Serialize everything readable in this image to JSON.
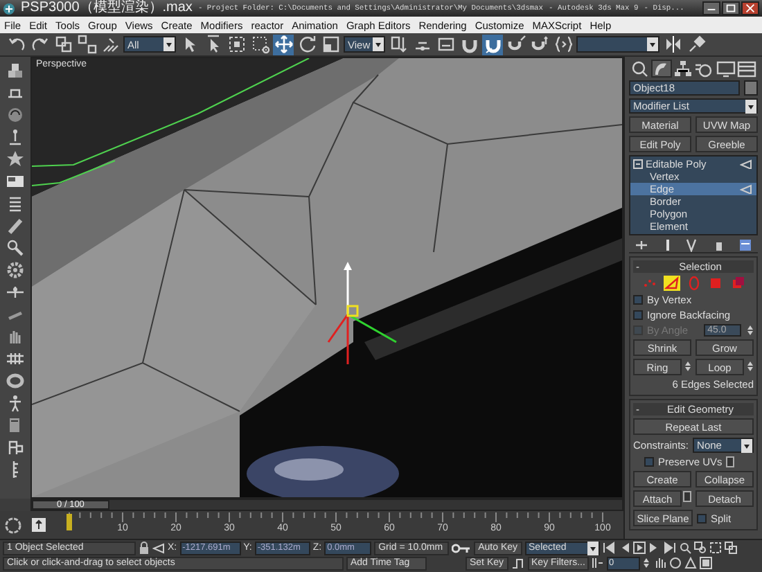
{
  "window": {
    "title_parts": [
      "PSP3000（模型渲染）.max",
      "- Project Folder: C:\\Documents and Settings\\Administrator\\My Documents\\3dsmax",
      "- Autodesk 3ds Max 9",
      "- Disp..."
    ]
  },
  "menu": [
    "File",
    "Edit",
    "Tools",
    "Group",
    "Views",
    "Create",
    "Modifiers",
    "reactor",
    "Animation",
    "Graph Editors",
    "Rendering",
    "Customize",
    "MAXScript",
    "Help"
  ],
  "toolbar": {
    "tools": [
      {
        "kind": "button",
        "selected": false
      },
      {
        "kind": "button",
        "selected": false
      },
      {
        "kind": "button",
        "selected": false
      },
      {
        "kind": "button",
        "selected": false
      },
      {
        "kind": "button",
        "selected": false
      },
      {
        "kind": "dropdown",
        "value": "All"
      },
      {
        "kind": "button",
        "selected": false
      },
      {
        "kind": "button",
        "selected": false
      },
      {
        "kind": "button",
        "selected": false
      },
      {
        "kind": "button",
        "selected": false
      },
      {
        "kind": "button",
        "selected": true
      },
      {
        "kind": "button",
        "selected": false
      },
      {
        "kind": "button",
        "selected": false
      },
      {
        "kind": "dropdown",
        "value": "View"
      },
      {
        "kind": "button",
        "selected": false
      },
      {
        "kind": "button",
        "selected": false
      },
      {
        "kind": "button",
        "selected": false
      },
      {
        "kind": "button",
        "selected": false
      },
      {
        "kind": "button",
        "selected": true
      },
      {
        "kind": "button",
        "selected": false
      },
      {
        "kind": "button",
        "selected": false
      },
      {
        "kind": "button",
        "selected": false
      },
      {
        "kind": "dropdown"
      },
      {
        "kind": "button",
        "selected": false
      },
      {
        "kind": "button",
        "selected": false
      }
    ]
  },
  "viewport": {
    "label": "Perspective"
  },
  "command_panel": {
    "tabs": [
      {
        "selected": false
      },
      {
        "selected": true
      },
      {
        "selected": false
      },
      {
        "selected": false
      },
      {
        "selected": false
      },
      {
        "selected": false
      }
    ],
    "object_name": "Object18",
    "modifier_list": "Modifier List",
    "modifier_buttons": [
      "Material",
      "UVW Map",
      "Edit Poly",
      "Greeble"
    ],
    "stack": [
      {
        "label": "Editable Poly",
        "selected": false,
        "expanded": true,
        "children": [
          {
            "label": "Vertex",
            "selected": false
          },
          {
            "label": "Edge",
            "selected": true
          },
          {
            "label": "Border",
            "selected": false
          },
          {
            "label": "Polygon",
            "selected": false
          },
          {
            "label": "Element",
            "selected": false
          }
        ]
      }
    ],
    "selection": {
      "collapse_mark": "-",
      "title": "Selection",
      "subobjects": [
        {
          "selected": false
        },
        {
          "selected": true
        },
        {
          "selected": false
        },
        {
          "selected": false
        },
        {
          "selected": false
        }
      ],
      "options": [
        {
          "kind": "checkbox",
          "label": "By Vertex",
          "checked": false
        },
        {
          "kind": "checkbox",
          "label": "Ignore Backfacing",
          "checked": false
        },
        {
          "kind": "angle",
          "label": "By Angle",
          "checked": false,
          "disabled": true,
          "value": "45.0"
        }
      ],
      "rows": [
        {
          "kind": "pair",
          "buttons": [
            "Shrink",
            "Grow"
          ]
        },
        {
          "kind": "spin_pair",
          "buttons": [
            "Ring",
            "Loop"
          ]
        }
      ],
      "status": "6 Edges Selected"
    },
    "edit_geometry": {
      "collapse_mark": "-",
      "title": "Edit Geometry",
      "repeat": "Repeat Last",
      "constraints_label": "Constraints:",
      "constraints_value": "None",
      "preserve_uvs": {
        "label": "Preserve UVs",
        "checked": false
      },
      "rows": [
        {
          "kind": "pair",
          "buttons": [
            "Create",
            "Collapse"
          ]
        },
        {
          "kind": "settings_pair",
          "buttons": [
            "Attach",
            "Detach"
          ]
        },
        {
          "kind": "check_pair",
          "buttons": [
            "Slice Plane"
          ],
          "check": {
            "label": "Split",
            "checked": false
          }
        }
      ]
    }
  },
  "timeline": {
    "slider_label": "0 / 100",
    "level": 0,
    "ticks": [
      "10",
      "20",
      "30",
      "40",
      "50",
      "60",
      "70",
      "80",
      "90",
      "100"
    ]
  },
  "status": {
    "selection": "1 Object Selected",
    "x_label": "X:",
    "x": "-1217.691m",
    "y_label": "Y:",
    "y": "-351.132m",
    "z_label": "Z:",
    "z": "0.0mm",
    "grid": "Grid = 10.0mm",
    "prompt": "Click or click-and-drag to select objects",
    "time_tag": "Add Time Tag",
    "auto_key": "Auto Key",
    "key_mode": "Selected",
    "set_key": "Set Key",
    "key_filters": "Key Filters...",
    "frame": "0"
  }
}
